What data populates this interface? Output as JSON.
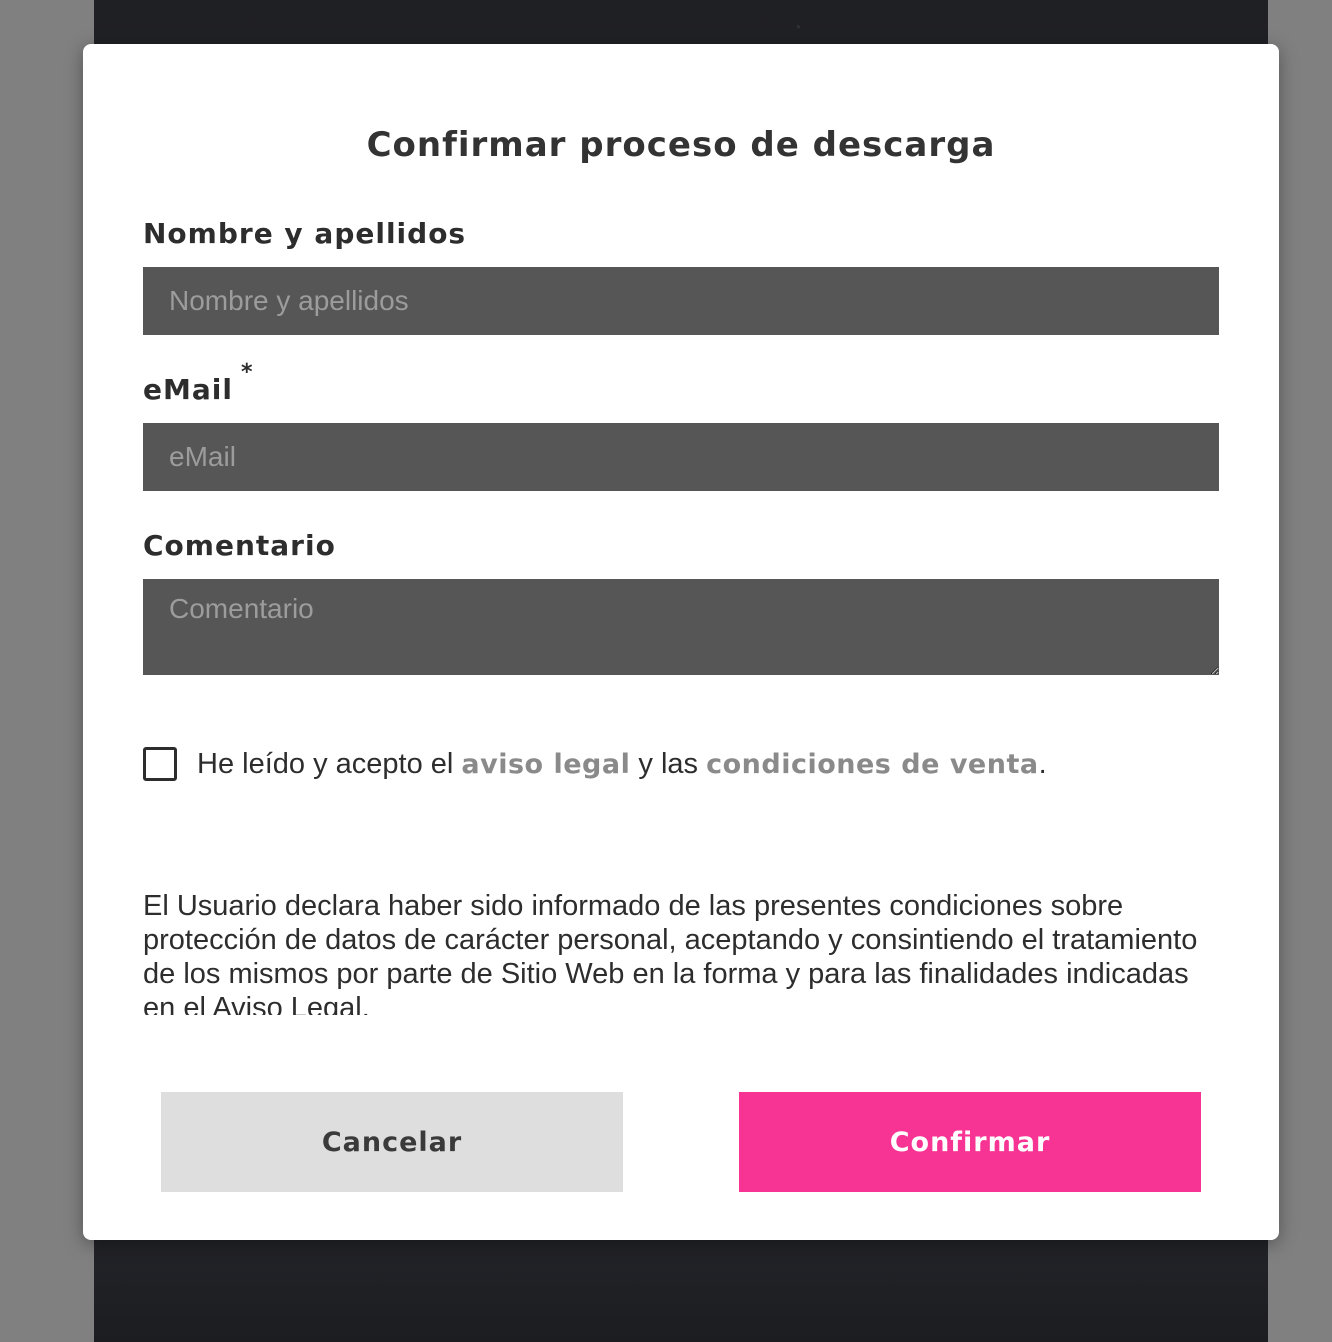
{
  "modal": {
    "title": "Confirmar proceso de descarga"
  },
  "form": {
    "name": {
      "label": "Nombre y apellidos",
      "placeholder": "Nombre y apellidos",
      "value": ""
    },
    "email": {
      "label": "eMail",
      "required_mark": "*",
      "placeholder": "eMail",
      "value": ""
    },
    "comment": {
      "label": "Comentario",
      "placeholder": "Comentario",
      "value": ""
    },
    "consent": {
      "checked": false,
      "text_before": "He leído y acepto el ",
      "link_legal": "aviso legal",
      "text_middle": " y las ",
      "link_conditions": "condiciones de venta",
      "text_after": "."
    },
    "disclaimer": "El Usuario declara haber sido informado de las presentes condiciones sobre protección de datos de carácter personal, aceptando y consintiendo el tratamiento de los mismos por parte de Sitio Web en la forma y para las finalidades indicadas en el Aviso Legal."
  },
  "buttons": {
    "cancel_label": "Cancelar",
    "confirm_label": "Confirmar"
  },
  "colors": {
    "confirm_accent": "#f73394",
    "cancel_bg": "#dedede",
    "input_bg": "#565656",
    "link_text": "#8a8a8a",
    "overlay": "#808080"
  }
}
